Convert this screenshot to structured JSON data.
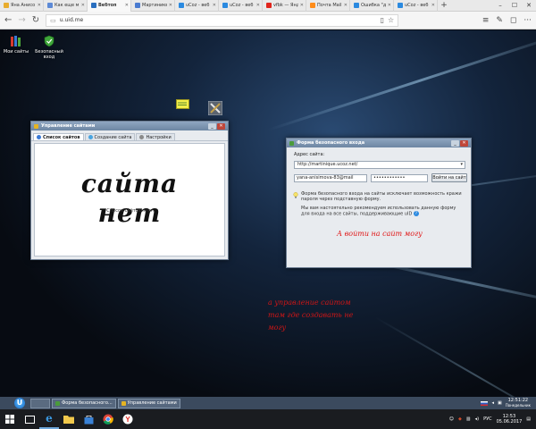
{
  "browser": {
    "tabs": [
      {
        "label": "Яна Анисо",
        "favicon_color": "#e8ac2e",
        "active": false
      },
      {
        "label": "Как еще м",
        "favicon_color": "#5d8ad6",
        "active": false
      },
      {
        "label": "Вебтоп",
        "favicon_color": "#2a6fbf",
        "active": true
      },
      {
        "label": "Мартиникв",
        "favicon_color": "#4a7bd0",
        "active": false
      },
      {
        "label": "uCoz - веб",
        "favicon_color": "#2b8ae0",
        "active": false
      },
      {
        "label": "uCoz - веб",
        "favicon_color": "#2b8ae0",
        "active": false
      },
      {
        "label": "vfbk — Янд",
        "favicon_color": "#e0251c",
        "active": false
      },
      {
        "label": "Почта Mail",
        "favicon_color": "#ff8c19",
        "active": false
      },
      {
        "label": "Ошибка \"д",
        "favicon_color": "#2b8ae0",
        "active": false
      },
      {
        "label": "uCoz - веб",
        "favicon_color": "#2b8ae0",
        "active": false
      }
    ],
    "new_tab": "+",
    "url": "u.uid.me"
  },
  "desktop": {
    "icons": [
      {
        "label": "Мои сайты"
      },
      {
        "label": "Безопасный вход"
      }
    ]
  },
  "sites_window": {
    "title": "Управление сайтами",
    "tabs": [
      {
        "label": "Список сайтов",
        "active": true
      },
      {
        "label": "Создание сайта",
        "active": false
      },
      {
        "label": "Настройки",
        "active": false
      }
    ],
    "handwritten": "сайта нет",
    "empty_text": "Список сайтов пуст."
  },
  "login_window": {
    "title": "Форма безопасного входа",
    "address_label": "Адрес сайта:",
    "address_value": "http://martinique.ucoz.net/",
    "login_value": "yana-anisimova-83@mail",
    "password_value": "••••••••••••",
    "login_button": "Войти на сайт",
    "info_1": "Форма безопасного входа на сайты исключает возможность кражи пароля через подставную форму.",
    "info_2": "Мы вам настоятельно рекомендуем использовать данную форму для входа на все сайты, поддерживающие uID",
    "note": "А войти на сайт могу"
  },
  "desktop_note": {
    "line1": "а управление сайтом",
    "line2": "там где создавать не",
    "line3": "могу"
  },
  "appbar": {
    "buttons": [
      {
        "label": "Форма безопасного...",
        "icon_color": "#4a9b3b"
      },
      {
        "label": "Управление сайтами",
        "icon_color": "#e6b422"
      }
    ],
    "clock_time": "12:51:22",
    "clock_day": "Понедельник"
  },
  "taskbar": {
    "lang": "РУС",
    "time": "12:53",
    "date": "05.06.2017"
  }
}
